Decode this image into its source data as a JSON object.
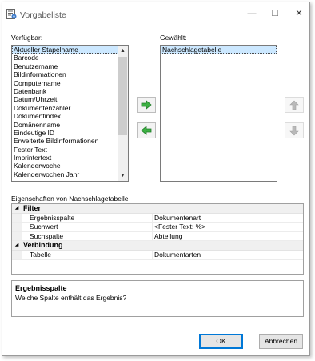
{
  "window": {
    "title": "Vorgabeliste",
    "icon": "list-settings-icon",
    "controls": {
      "minimize": "—",
      "maximize": "☐",
      "close": "✕"
    }
  },
  "available": {
    "label": "Verfügbar:",
    "items": [
      "Aktueller Stapelname",
      "Barcode",
      "Benutzername",
      "Bildinformationen",
      "Computername",
      "Datenbank",
      "Datum/Uhrzeit",
      "Dokumentenzähler",
      "Dokumentindex",
      "Domänenname",
      "Eindeutige ID",
      "Erweiterte Bildinformationen",
      "Fester Text",
      "Imprintertext",
      "Kalenderwoche",
      "Kalenderwochen Jahr"
    ],
    "selected_index": 0
  },
  "selected": {
    "label": "Gewählt:",
    "items": [
      "Nachschlagetabelle"
    ],
    "selected_index": 0
  },
  "move_buttons": {
    "add_icon": "arrow-right-icon",
    "remove_icon": "arrow-left-icon",
    "up_icon": "arrow-up-icon",
    "down_icon": "arrow-down-icon",
    "add_color": "#3cb043",
    "up_down_color": "#b9b9b9"
  },
  "properties": {
    "label": "Eigenschaften von Nachschlagetabelle",
    "groups": [
      {
        "name": "Filter",
        "rows": [
          {
            "name": "Ergebnisspalte",
            "value": "Dokumentenart"
          },
          {
            "name": "Suchwert",
            "value": "<Fester Text: %>"
          },
          {
            "name": "Suchspalte",
            "value": "Abteilung"
          }
        ]
      },
      {
        "name": "Verbindung",
        "rows": [
          {
            "name": "Tabelle",
            "value": "Dokumentarten"
          }
        ]
      }
    ]
  },
  "description": {
    "title": "Ergebnisspalte",
    "text": "Welche Spalte enthält das Ergebnis?"
  },
  "buttons": {
    "ok": "OK",
    "cancel": "Abbrechen"
  }
}
